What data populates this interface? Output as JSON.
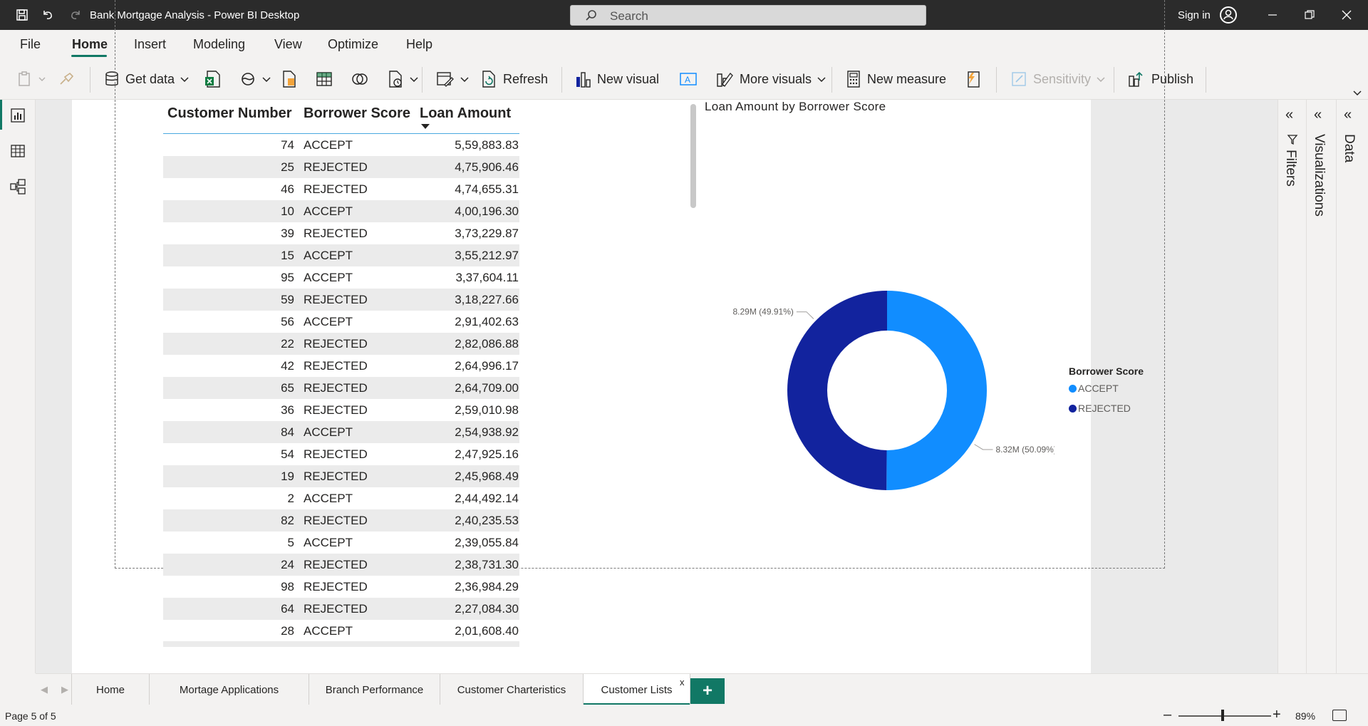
{
  "window": {
    "title": "Bank Mortgage Analysis - Power BI Desktop",
    "search_placeholder": "Search",
    "sign_in": "Sign in"
  },
  "menu": {
    "tabs": [
      "File",
      "Home",
      "Insert",
      "Modeling",
      "View",
      "Optimize",
      "Help"
    ],
    "active": "Home"
  },
  "ribbon": {
    "get_data": "Get data",
    "refresh": "Refresh",
    "new_visual": "New visual",
    "more_visuals": "More visuals",
    "new_measure": "New measure",
    "sensitivity": "Sensitivity",
    "publish": "Publish"
  },
  "table": {
    "headers": [
      "Customer Number",
      "Borrower Score",
      "Loan Amount"
    ],
    "sorted_column": "Loan Amount",
    "sort_direction": "descending",
    "rows": [
      [
        "74",
        "ACCEPT",
        "5,59,883.83"
      ],
      [
        "25",
        "REJECTED",
        "4,75,906.46"
      ],
      [
        "46",
        "REJECTED",
        "4,74,655.31"
      ],
      [
        "10",
        "ACCEPT",
        "4,00,196.30"
      ],
      [
        "39",
        "REJECTED",
        "3,73,229.87"
      ],
      [
        "15",
        "ACCEPT",
        "3,55,212.97"
      ],
      [
        "95",
        "ACCEPT",
        "3,37,604.11"
      ],
      [
        "59",
        "REJECTED",
        "3,18,227.66"
      ],
      [
        "56",
        "ACCEPT",
        "2,91,402.63"
      ],
      [
        "22",
        "REJECTED",
        "2,82,086.88"
      ],
      [
        "42",
        "REJECTED",
        "2,64,996.17"
      ],
      [
        "65",
        "REJECTED",
        "2,64,709.00"
      ],
      [
        "36",
        "REJECTED",
        "2,59,010.98"
      ],
      [
        "84",
        "ACCEPT",
        "2,54,938.92"
      ],
      [
        "54",
        "REJECTED",
        "2,47,925.16"
      ],
      [
        "19",
        "REJECTED",
        "2,45,968.49"
      ],
      [
        "2",
        "ACCEPT",
        "2,44,492.14"
      ],
      [
        "82",
        "REJECTED",
        "2,40,235.53"
      ],
      [
        "5",
        "ACCEPT",
        "2,39,055.84"
      ],
      [
        "24",
        "REJECTED",
        "2,38,731.30"
      ],
      [
        "98",
        "REJECTED",
        "2,36,984.29"
      ],
      [
        "64",
        "REJECTED",
        "2,27,084.30"
      ],
      [
        "28",
        "ACCEPT",
        "2,01,608.40"
      ]
    ]
  },
  "chart_data": {
    "type": "pie",
    "variant": "donut",
    "title": "Loan Amount by Borrower Score",
    "legend_title": "Borrower Score",
    "legend_position": "right",
    "categories": [
      "ACCEPT",
      "REJECTED"
    ],
    "values": [
      8.32,
      8.29
    ],
    "unit": "M",
    "percentages": [
      50.09,
      49.91
    ],
    "labels": [
      "8.32M (50.09%)",
      "8.29M (49.91%)"
    ],
    "colors": [
      "#118dff",
      "#12239e"
    ]
  },
  "panes": {
    "filters": "Filters",
    "visualizations": "Visualizations",
    "data": "Data"
  },
  "page_tabs": {
    "tabs": [
      "Home",
      "Mortage Applications",
      "Branch Performance",
      "Customer Charteristics",
      "Customer Lists"
    ],
    "active": "Customer Lists",
    "close": "x",
    "add": "+"
  },
  "status": {
    "page": "Page 5 of 5",
    "zoom": "89%",
    "zoom_minus": "–",
    "zoom_plus": "+"
  },
  "colors": {
    "accent": "#117865",
    "accept": "#118dff",
    "rejected": "#12239e"
  }
}
